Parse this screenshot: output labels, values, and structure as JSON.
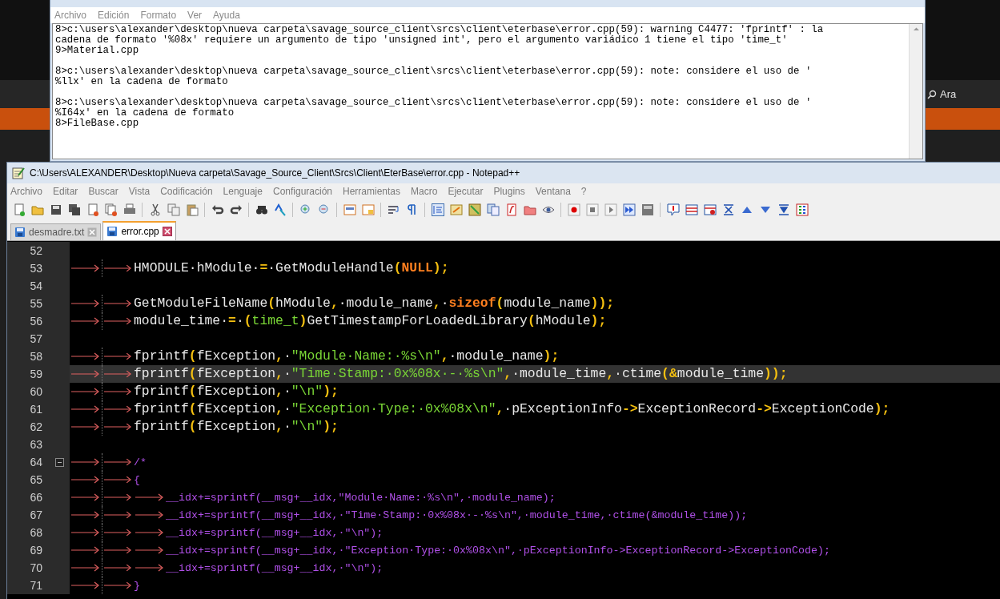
{
  "desktop": {
    "search_label": "Ara"
  },
  "notepad": {
    "menu": [
      "Archivo",
      "Edición",
      "Formato",
      "Ver",
      "Ayuda"
    ],
    "blocks": [
      [
        "8>c:\\users\\alexander\\desktop\\nueva carpeta\\savage_source_client\\srcs\\client\\eterbase\\error.cpp(59): warning C4477: 'fprintf' : la",
        "cadena de formato '%08x' requiere un argumento de tipo 'unsigned int', pero el argumento variádico 1 tiene el tipo 'time_t'",
        "9>Material.cpp"
      ],
      [
        "8>c:\\users\\alexander\\desktop\\nueva carpeta\\savage_source_client\\srcs\\client\\eterbase\\error.cpp(59): note: considere el uso de '",
        "%llx' en la cadena de formato"
      ],
      [
        "8>c:\\users\\alexander\\desktop\\nueva carpeta\\savage_source_client\\srcs\\client\\eterbase\\error.cpp(59): note: considere el uso de '",
        "%I64x' en la cadena de formato",
        "8>FileBase.cpp"
      ]
    ]
  },
  "notepadpp": {
    "title": "C:\\Users\\ALEXANDER\\Desktop\\Nueva carpeta\\Savage_Source_Client\\Srcs\\Client\\EterBase\\error.cpp - Notepad++",
    "menu": [
      "Archivo",
      "Editar",
      "Buscar",
      "Vista",
      "Codificación",
      "Lenguaje",
      "Configuración",
      "Herramientas",
      "Macro",
      "Ejecutar",
      "Plugins",
      "Ventana",
      "?"
    ],
    "tabs": [
      {
        "label": "desmadre.txt",
        "selected": false
      },
      {
        "label": "error.cpp",
        "selected": true
      }
    ],
    "lines": [
      {
        "number": "52",
        "current": false,
        "fold": false
      },
      {
        "number": "53",
        "current": false,
        "fold": false,
        "tokens": [
          {
            "kind": "tab"
          },
          {
            "kind": "tab"
          },
          {
            "kind": "plain",
            "text": "HMODULE·hModule·"
          },
          {
            "kind": "op",
            "text": "="
          },
          {
            "kind": "plain",
            "text": "·GetModuleHandle"
          },
          {
            "kind": "op",
            "text": "("
          },
          {
            "kind": "keyword",
            "text": "NULL"
          },
          {
            "kind": "op",
            "text": ");"
          }
        ]
      },
      {
        "number": "54",
        "current": false,
        "fold": false
      },
      {
        "number": "55",
        "current": false,
        "fold": false,
        "tokens": [
          {
            "kind": "tab"
          },
          {
            "kind": "tab"
          },
          {
            "kind": "plain",
            "text": "GetModuleFileName"
          },
          {
            "kind": "op",
            "text": "("
          },
          {
            "kind": "plain",
            "text": "hModule"
          },
          {
            "kind": "op",
            "text": ","
          },
          {
            "kind": "plain",
            "text": "·module_name"
          },
          {
            "kind": "op",
            "text": ","
          },
          {
            "kind": "plain",
            "text": "·"
          },
          {
            "kind": "keyword",
            "text": "sizeof"
          },
          {
            "kind": "op",
            "text": "("
          },
          {
            "kind": "plain",
            "text": "module_name"
          },
          {
            "kind": "op",
            "text": "));"
          }
        ]
      },
      {
        "number": "56",
        "current": false,
        "fold": false,
        "tokens": [
          {
            "kind": "tab"
          },
          {
            "kind": "tab"
          },
          {
            "kind": "plain",
            "text": "module_time·"
          },
          {
            "kind": "op",
            "text": "="
          },
          {
            "kind": "plain",
            "text": "·"
          },
          {
            "kind": "op",
            "text": "("
          },
          {
            "kind": "type",
            "text": "time_t"
          },
          {
            "kind": "op",
            "text": ")"
          },
          {
            "kind": "plain",
            "text": "GetTimestampForLoadedLibrary"
          },
          {
            "kind": "op",
            "text": "("
          },
          {
            "kind": "plain",
            "text": "hModule"
          },
          {
            "kind": "op",
            "text": ");"
          }
        ]
      },
      {
        "number": "57",
        "current": false,
        "fold": false
      },
      {
        "number": "58",
        "current": false,
        "fold": false,
        "tokens": [
          {
            "kind": "tab"
          },
          {
            "kind": "tab"
          },
          {
            "kind": "plain",
            "text": "fprintf"
          },
          {
            "kind": "op",
            "text": "("
          },
          {
            "kind": "plain",
            "text": "fException"
          },
          {
            "kind": "op",
            "text": ","
          },
          {
            "kind": "plain",
            "text": "·"
          },
          {
            "kind": "string",
            "text": "\"Module·Name:·%s\\n\""
          },
          {
            "kind": "op",
            "text": ","
          },
          {
            "kind": "plain",
            "text": "·module_name"
          },
          {
            "kind": "op",
            "text": ");"
          }
        ]
      },
      {
        "number": "59",
        "current": true,
        "fold": false,
        "tokens": [
          {
            "kind": "tab"
          },
          {
            "kind": "tab"
          },
          {
            "kind": "plain",
            "text": "fprintf"
          },
          {
            "kind": "op",
            "text": "("
          },
          {
            "kind": "plain",
            "text": "fException"
          },
          {
            "kind": "op",
            "text": ","
          },
          {
            "kind": "plain",
            "text": "·"
          },
          {
            "kind": "string",
            "text": "\"Time·Stamp:·0x%08x·-·%s\\n\""
          },
          {
            "kind": "op",
            "text": ","
          },
          {
            "kind": "plain",
            "text": "·module_time"
          },
          {
            "kind": "op",
            "text": ","
          },
          {
            "kind": "plain",
            "text": "·ctime"
          },
          {
            "kind": "op",
            "text": "(&"
          },
          {
            "kind": "plain",
            "text": "module_time"
          },
          {
            "kind": "op",
            "text": "));"
          }
        ]
      },
      {
        "number": "60",
        "current": false,
        "fold": false,
        "tokens": [
          {
            "kind": "tab"
          },
          {
            "kind": "tab"
          },
          {
            "kind": "plain",
            "text": "fprintf"
          },
          {
            "kind": "op",
            "text": "("
          },
          {
            "kind": "plain",
            "text": "fException"
          },
          {
            "kind": "op",
            "text": ","
          },
          {
            "kind": "plain",
            "text": "·"
          },
          {
            "kind": "string",
            "text": "\"\\n\""
          },
          {
            "kind": "op",
            "text": ");"
          }
        ]
      },
      {
        "number": "61",
        "current": false,
        "fold": false,
        "tokens": [
          {
            "kind": "tab"
          },
          {
            "kind": "tab"
          },
          {
            "kind": "plain",
            "text": "fprintf"
          },
          {
            "kind": "op",
            "text": "("
          },
          {
            "kind": "plain",
            "text": "fException"
          },
          {
            "kind": "op",
            "text": ","
          },
          {
            "kind": "plain",
            "text": "·"
          },
          {
            "kind": "string",
            "text": "\"Exception·Type:·0x%08x\\n\""
          },
          {
            "kind": "op",
            "text": ","
          },
          {
            "kind": "plain",
            "text": "·pExceptionInfo"
          },
          {
            "kind": "op",
            "text": "->"
          },
          {
            "kind": "plain",
            "text": "ExceptionRecord"
          },
          {
            "kind": "op",
            "text": "->"
          },
          {
            "kind": "plain",
            "text": "ExceptionCode"
          },
          {
            "kind": "op",
            "text": ");"
          }
        ]
      },
      {
        "number": "62",
        "current": false,
        "fold": false,
        "tokens": [
          {
            "kind": "tab"
          },
          {
            "kind": "tab"
          },
          {
            "kind": "plain",
            "text": "fprintf"
          },
          {
            "kind": "op",
            "text": "("
          },
          {
            "kind": "plain",
            "text": "fException"
          },
          {
            "kind": "op",
            "text": ","
          },
          {
            "kind": "plain",
            "text": "·"
          },
          {
            "kind": "string",
            "text": "\"\\n\""
          },
          {
            "kind": "op",
            "text": ");"
          }
        ]
      },
      {
        "number": "63",
        "current": false,
        "fold": false
      },
      {
        "number": "64",
        "current": false,
        "fold": true,
        "tokens": [
          {
            "kind": "tab"
          },
          {
            "kind": "tab"
          },
          {
            "kind": "comment",
            "text": "/*"
          }
        ]
      },
      {
        "number": "65",
        "current": false,
        "fold": false,
        "tokens": [
          {
            "kind": "tab"
          },
          {
            "kind": "tab"
          },
          {
            "kind": "comment",
            "text": "{"
          }
        ]
      },
      {
        "number": "66",
        "current": false,
        "fold": false,
        "tokens": [
          {
            "kind": "tab"
          },
          {
            "kind": "tab"
          },
          {
            "kind": "tab"
          },
          {
            "kind": "comment",
            "text": "__idx+=sprintf(__msg+__idx,\"Module·Name:·%s\\n\",·module_name);"
          }
        ]
      },
      {
        "number": "67",
        "current": false,
        "fold": false,
        "tokens": [
          {
            "kind": "tab"
          },
          {
            "kind": "tab"
          },
          {
            "kind": "tab"
          },
          {
            "kind": "comment",
            "text": "__idx+=sprintf(__msg+__idx,·\"Time·Stamp:·0x%08x·-·%s\\n\",·module_time,·ctime(&module_time));"
          }
        ]
      },
      {
        "number": "68",
        "current": false,
        "fold": false,
        "tokens": [
          {
            "kind": "tab"
          },
          {
            "kind": "tab"
          },
          {
            "kind": "tab"
          },
          {
            "kind": "comment",
            "text": "__idx+=sprintf(__msg+__idx,·\"\\n\");"
          }
        ]
      },
      {
        "number": "69",
        "current": false,
        "fold": false,
        "tokens": [
          {
            "kind": "tab"
          },
          {
            "kind": "tab"
          },
          {
            "kind": "tab"
          },
          {
            "kind": "comment",
            "text": "__idx+=sprintf(__msg+__idx,·\"Exception·Type:·0x%08x\\n\",·pExceptionInfo->ExceptionRecord->ExceptionCode);"
          }
        ]
      },
      {
        "number": "70",
        "current": false,
        "fold": false,
        "tokens": [
          {
            "kind": "tab"
          },
          {
            "kind": "tab"
          },
          {
            "kind": "tab"
          },
          {
            "kind": "comment",
            "text": "__idx+=sprintf(__msg+__idx,·\"\\n\");"
          }
        ]
      },
      {
        "number": "71",
        "current": false,
        "fold": false,
        "tokens": [
          {
            "kind": "tab"
          },
          {
            "kind": "tab"
          },
          {
            "kind": "comment",
            "text": "}"
          }
        ]
      }
    ]
  }
}
